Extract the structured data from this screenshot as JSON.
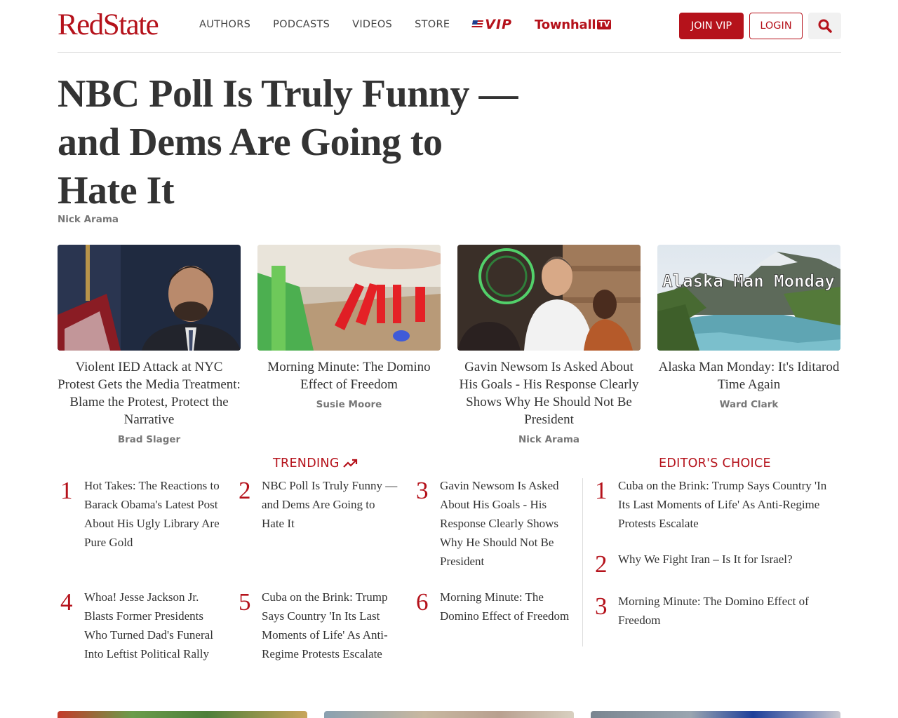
{
  "header": {
    "logo_part1": "Red",
    "logo_part2": "State",
    "nav": [
      "AUTHORS",
      "PODCASTS",
      "VIDEOS",
      "STORE"
    ],
    "vip_label": "VIP",
    "townhall_label": "Townhall",
    "townhall_tv": "TV",
    "join_label": "JOIN VIP",
    "login_label": "LOGIN",
    "search_icon": "search-icon"
  },
  "headline": {
    "title": "NBC Poll Is Truly Funny — and Dems Are Going to Hate It",
    "author": "Nick Arama"
  },
  "cards": [
    {
      "title": "Violent IED Attack at NYC Protest Gets the Media Treatment: Blame the Protest, Protect the Narrative",
      "author": "Brad Slager"
    },
    {
      "title": "Morning Minute: The Domino Effect of Freedom",
      "author": "Susie Moore"
    },
    {
      "title": "Gavin Newsom Is Asked About His Goals - His Response Clearly Shows Why He Should Not Be President",
      "author": "Nick Arama"
    },
    {
      "title": "Alaska Man Monday: It's Iditarod Time Again",
      "author": "Ward Clark",
      "image_text": "Alaska Man Monday"
    }
  ],
  "trending": {
    "title": "TRENDING",
    "items": [
      {
        "num": "1",
        "text": "Hot Takes: The Reactions to Barack Obama's Latest Post About His Ugly Library Are Pure Gold"
      },
      {
        "num": "2",
        "text": "NBC Poll Is Truly Funny — and Dems Are Going to Hate It"
      },
      {
        "num": "3",
        "text": "Gavin Newsom Is Asked About His Goals - His Response Clearly Shows Why He Should Not Be President"
      },
      {
        "num": "4",
        "text": "Whoa! Jesse Jackson Jr. Blasts Former Presidents Who Turned Dad's Funeral Into Leftist Political Rally"
      },
      {
        "num": "5",
        "text": "Cuba on the Brink: Trump Says Country 'In Its Last Moments of Life' As Anti-Regime Protests Escalate"
      },
      {
        "num": "6",
        "text": "Morning Minute: The Domino Effect of Freedom"
      }
    ]
  },
  "editors_choice": {
    "title": "EDITOR'S CHOICE",
    "items": [
      {
        "num": "1",
        "text": "Cuba on the Brink: Trump Says Country 'In Its Last Moments of Life' As Anti-Regime Protests Escalate"
      },
      {
        "num": "2",
        "text": "Why We Fight Iran – Is It for Israel?"
      },
      {
        "num": "3",
        "text": "Morning Minute: The Domino Effect of Freedom"
      }
    ]
  },
  "colors": {
    "brand_red": "#b5121b",
    "text": "#333333",
    "muted": "#777777"
  }
}
